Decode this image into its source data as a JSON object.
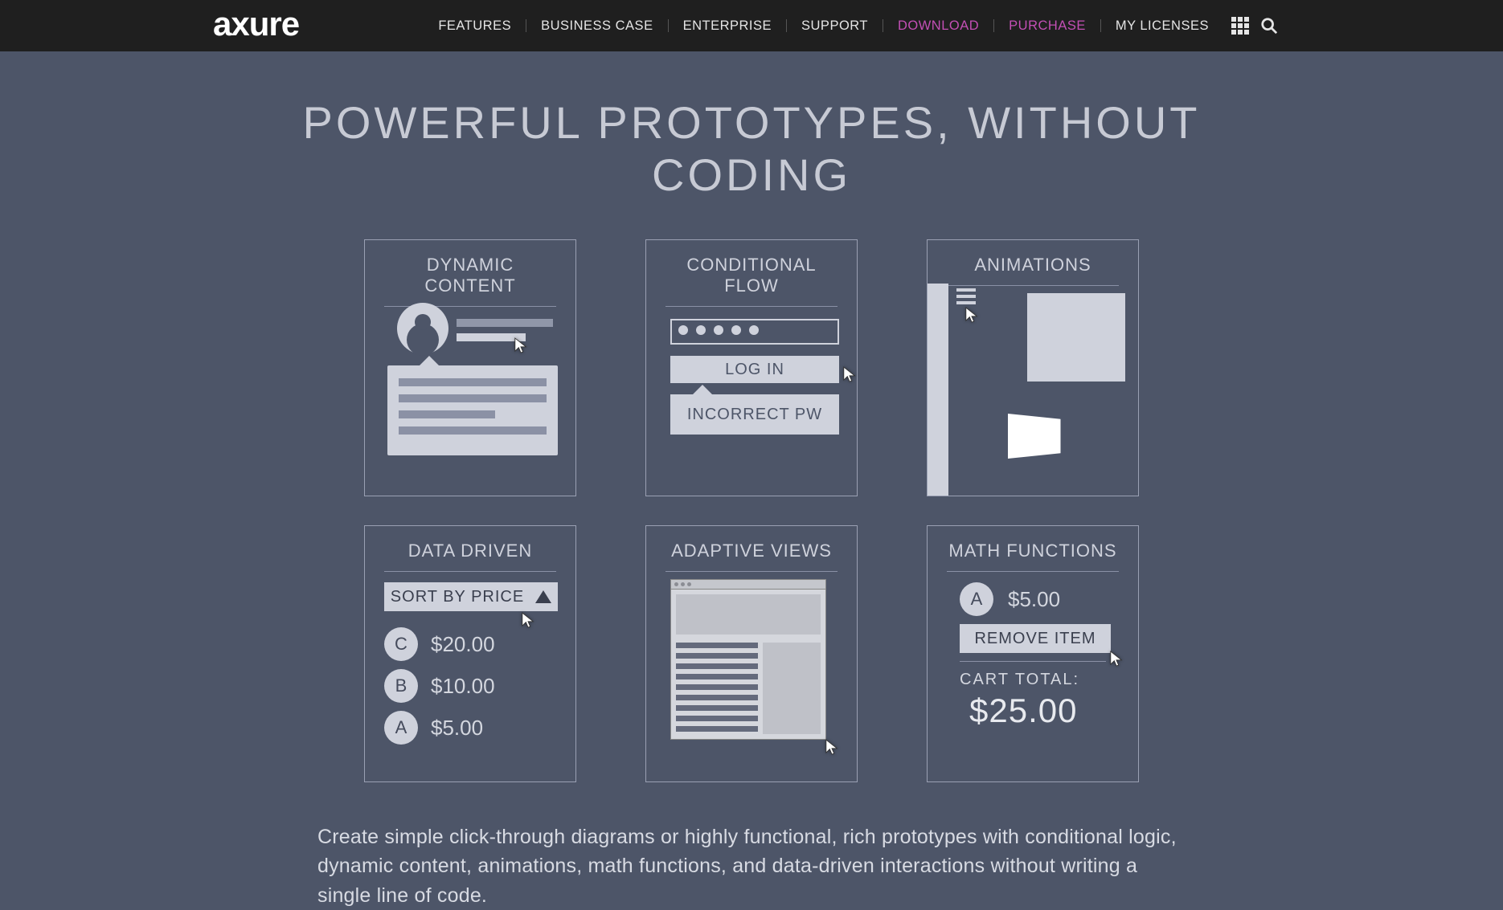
{
  "brand": "axure",
  "nav": {
    "items": [
      {
        "label": "FEATURES",
        "pink": false
      },
      {
        "label": "BUSINESS CASE",
        "pink": false
      },
      {
        "label": "ENTERPRISE",
        "pink": false
      },
      {
        "label": "SUPPORT",
        "pink": false
      },
      {
        "label": "DOWNLOAD",
        "pink": true
      },
      {
        "label": "PURCHASE",
        "pink": true
      },
      {
        "label": "MY LICENSES",
        "pink": false
      }
    ]
  },
  "headline": "POWERFUL PROTOTYPES, WITHOUT CODING",
  "cards": {
    "dynamic": {
      "title": "DYNAMIC CONTENT"
    },
    "conditional": {
      "title": "CONDITIONAL FLOW",
      "login": "LOG IN",
      "error": "INCORRECT PW"
    },
    "animations": {
      "title": "ANIMATIONS"
    },
    "data": {
      "title": "DATA DRIVEN",
      "sort": "SORT BY PRICE",
      "rows": [
        {
          "letter": "C",
          "price": "$20.00"
        },
        {
          "letter": "B",
          "price": "$10.00"
        },
        {
          "letter": "A",
          "price": "$5.00"
        }
      ]
    },
    "adaptive": {
      "title": "ADAPTIVE VIEWS"
    },
    "math": {
      "title": "MATH FUNCTIONS",
      "item_letter": "A",
      "item_price": "$5.00",
      "remove": "REMOVE ITEM",
      "cart_label": "CART TOTAL:",
      "cart_total": "$25.00"
    }
  },
  "description": "Create simple click-through diagrams or highly functional, rich prototypes with conditional logic, dynamic content, animations, math functions, and data-driven interactions without writing a single line of code."
}
